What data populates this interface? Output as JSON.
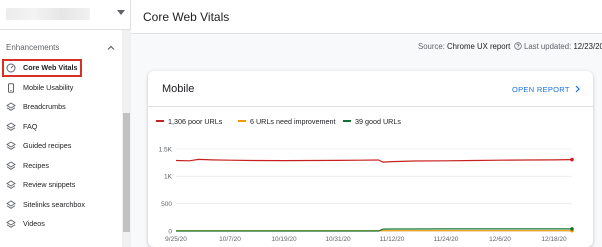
{
  "app": {
    "title": "Core Web Vitals"
  },
  "sidebar": {
    "section_label": "Enhancements",
    "items": [
      {
        "label": "Core Web Vitals",
        "icon": "speed-icon",
        "active": true
      },
      {
        "label": "Mobile Usability",
        "icon": "phone-icon"
      },
      {
        "label": "Breadcrumbs",
        "icon": "layers-icon"
      },
      {
        "label": "FAQ",
        "icon": "layers-icon"
      },
      {
        "label": "Guided recipes",
        "icon": "layers-icon"
      },
      {
        "label": "Recipes",
        "icon": "layers-icon"
      },
      {
        "label": "Review snippets",
        "icon": "layers-icon"
      },
      {
        "label": "Sitelinks searchbox",
        "icon": "layers-icon"
      },
      {
        "label": "Videos",
        "icon": "layers-icon"
      }
    ]
  },
  "meta": {
    "source_prefix": "Source:",
    "source_value": "Chrome UX report",
    "updated_prefix": "Last updated:",
    "updated_value": "12/23/20"
  },
  "card": {
    "title": "Mobile",
    "open_report": "OPEN REPORT"
  },
  "colors": {
    "poor": "#c5221f",
    "needs_improvement": "#f29900",
    "good": "#137333",
    "accent": "#1a73e8"
  },
  "chart_data": {
    "type": "line",
    "x": [
      "9/25/20",
      "9/28/20",
      "9/30/20",
      "10/3/20",
      "10/7/20",
      "10/12/20",
      "10/19/20",
      "10/25/20",
      "10/31/20",
      "11/5/20",
      "11/9/20",
      "11/10/20",
      "11/12/20",
      "11/17/20",
      "11/24/20",
      "11/30/20",
      "12/6/20",
      "12/12/20",
      "12/18/20",
      "12/22/20"
    ],
    "x_ticks": [
      "9/25/20",
      "10/7/20",
      "10/19/20",
      "10/31/20",
      "11/12/20",
      "11/24/20",
      "12/6/20",
      "12/18/20"
    ],
    "y_ticks": [
      "1.5K",
      "1K",
      "500",
      "0"
    ],
    "ylim": [
      0,
      1500
    ],
    "series": [
      {
        "name": "1,306 poor URLs",
        "key": "poor",
        "values": [
          1290,
          1285,
          1310,
          1300,
          1295,
          1290,
          1288,
          1290,
          1292,
          1295,
          1298,
          1260,
          1270,
          1280,
          1285,
          1290,
          1295,
          1298,
          1300,
          1306
        ]
      },
      {
        "name": "6 URLs need improvement",
        "key": "needs_improvement",
        "values": [
          6,
          6,
          6,
          6,
          6,
          6,
          6,
          6,
          6,
          6,
          6,
          6,
          6,
          6,
          6,
          6,
          6,
          6,
          6,
          6
        ]
      },
      {
        "name": "39 good URLs",
        "key": "good",
        "values": [
          0,
          0,
          0,
          0,
          0,
          0,
          0,
          0,
          0,
          0,
          0,
          35,
          36,
          37,
          38,
          38,
          38,
          39,
          39,
          39
        ]
      }
    ]
  }
}
